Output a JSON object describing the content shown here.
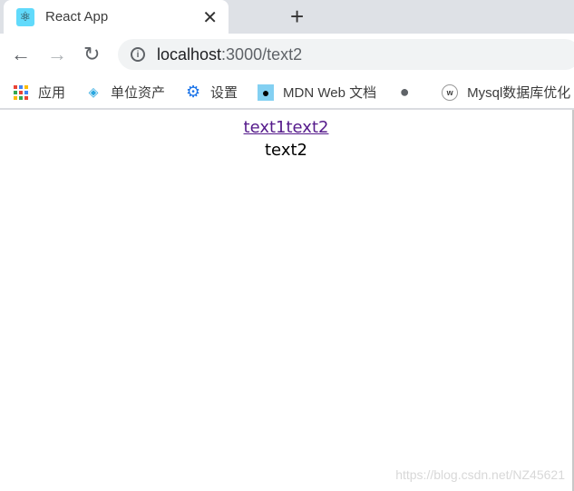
{
  "browser": {
    "tab": {
      "title": "React App",
      "favicon": "react-icon",
      "close": "✕"
    },
    "new_tab": "+",
    "url": {
      "host": "localhost",
      "rest": ":3000/text2"
    },
    "bookmarks": [
      {
        "label": "应用",
        "icon": "apps-grid-icon"
      },
      {
        "label": "单位资产",
        "icon": "asset-icon"
      },
      {
        "label": "设置",
        "icon": "gear-icon"
      },
      {
        "label": "MDN Web 文档",
        "icon": "mdn-icon"
      },
      {
        "label": "",
        "icon": "globe-icon"
      },
      {
        "label": "Mysql数据库优化",
        "icon": "w-icon"
      }
    ]
  },
  "page": {
    "link": "text1text2",
    "text": "text2"
  },
  "watermark": "https://blog.csdn.net/NZ45621",
  "colors": {
    "link_visited": "#551a8b",
    "tabstrip": "#dee1e6",
    "omnibox": "#f1f3f4"
  }
}
